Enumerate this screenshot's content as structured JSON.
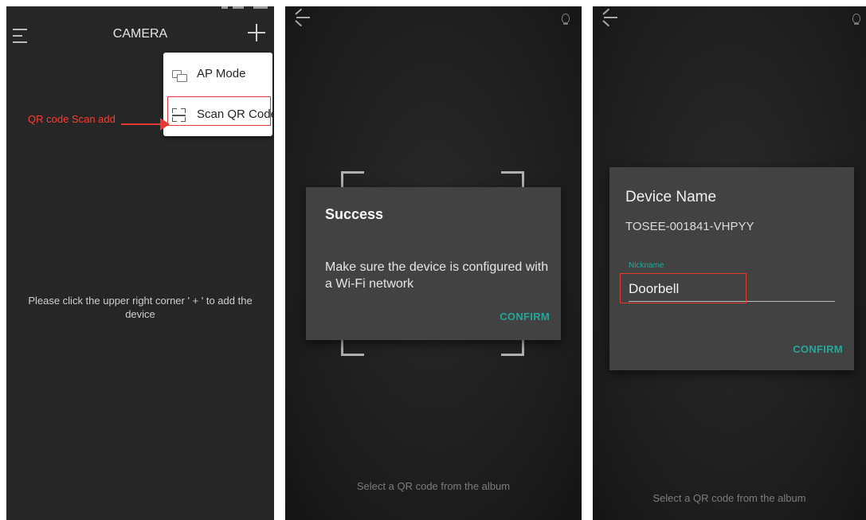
{
  "panel1": {
    "title": "CAMERA",
    "menu": {
      "items": [
        {
          "label": "AP Mode",
          "icon": "ap-mode-icon"
        },
        {
          "label": "Scan QR Code",
          "icon": "qr-scan-icon"
        }
      ]
    },
    "annotation": "QR code Scan add",
    "hint": "Please click the upper right corner ' + ' to add the device"
  },
  "panel2": {
    "dialog": {
      "title": "Success",
      "message": "Make sure the device is configured with a Wi-Fi network",
      "confirm": "CONFIRM"
    },
    "album_link": "Select a QR code from the album"
  },
  "panel3": {
    "dialog": {
      "title": "Device Name",
      "device_id": "TOSEE-001841-VHPYY",
      "nickname_label": "Nickname",
      "nickname_value": "Doorbell",
      "confirm": "CONFIRM"
    },
    "album_link": "Select a QR code from the album"
  },
  "colors": {
    "accent": "#26a69a",
    "annotation_red": "#e53935",
    "dialog_bg": "#424242",
    "screen_bg": "#262626"
  }
}
